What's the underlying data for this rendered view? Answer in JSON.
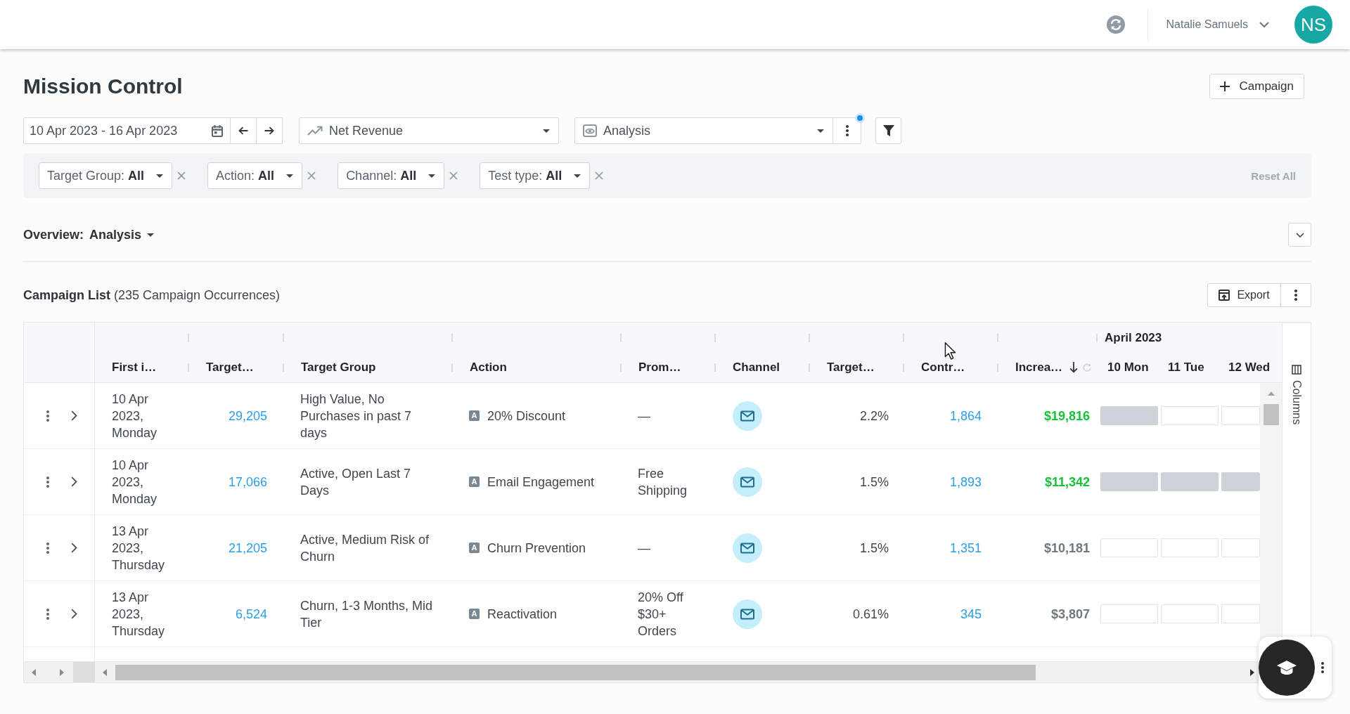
{
  "top_bar": {
    "user_name": "Natalie Samuels",
    "avatar_initials": "NS"
  },
  "header": {
    "title": "Mission Control",
    "new_button": "Campaign"
  },
  "toolbar": {
    "date_range": "10 Apr 2023 - 16 Apr 2023",
    "metric": "Net Revenue",
    "view": "Analysis",
    "view_menu_badge": true
  },
  "filters": {
    "items": [
      {
        "label": "Target Group:",
        "value": "All"
      },
      {
        "label": "Action:",
        "value": "All"
      },
      {
        "label": "Channel:",
        "value": "All"
      },
      {
        "label": "Test type:",
        "value": "All"
      }
    ],
    "reset": {
      "label": "Reset All",
      "disabled": true
    }
  },
  "overview": {
    "label": "Overview:",
    "value": "Analysis"
  },
  "campaign_list": {
    "title": "Campaign List",
    "count": "(235 Campaign Occurrences)",
    "export": "Export"
  },
  "table": {
    "columns": [
      {
        "label": "First i…",
        "kind": "text",
        "sorted": false
      },
      {
        "label": "Target…",
        "kind": "link",
        "sorted": false
      },
      {
        "label": "Target Group",
        "kind": "text",
        "sorted": false
      },
      {
        "label": "Action",
        "kind": "tagged",
        "sorted": false
      },
      {
        "label": "Prom…",
        "kind": "text",
        "sorted": false
      },
      {
        "label": "Channel",
        "kind": "icon",
        "sorted": false
      },
      {
        "label": "Target…",
        "kind": "number",
        "sorted": false
      },
      {
        "label": "Contr…",
        "kind": "link",
        "sorted": false
      },
      {
        "label": "Increa…",
        "kind": "money",
        "sorted": true
      }
    ],
    "group_header": "April 2023",
    "day_columns": [
      "10 Mon",
      "11 Tue",
      "12 Wed"
    ],
    "rows": [
      {
        "significant": true,
        "badge": "A",
        "cells": [
          "10 Apr 2023, Monday",
          "29,205",
          "High Value, No Purchases in past 7 days",
          "20% Discount",
          "—",
          "2.2%",
          "1,864",
          "$19,816"
        ],
        "days": [
          {
            "active": true
          },
          {
            "active": false
          },
          {
            "active": false
          }
        ]
      },
      {
        "significant": true,
        "badge": "A",
        "cells": [
          "10 Apr 2023, Monday",
          "17,066",
          "Active, Open Last 7 Days",
          "Email Engagement",
          "Free Shipping",
          "1.5%",
          "1,893",
          "$11,342"
        ],
        "days": [
          {
            "active": true
          },
          {
            "active": true
          },
          {
            "active": true
          }
        ]
      },
      {
        "significant": false,
        "badge": "A",
        "cells": [
          "13 Apr 2023, Thursday",
          "21,205",
          "Active, Medium Risk of Churn",
          "Churn Prevention",
          "—",
          "1.5%",
          "1,351",
          "$10,181"
        ],
        "days": [
          {
            "active": false
          },
          {
            "active": false
          },
          {
            "active": false
          }
        ]
      },
      {
        "significant": false,
        "badge": "A",
        "cells": [
          "13 Apr 2023, Thursday",
          "6,524",
          "Churn, 1-3 Months, Mid Tier",
          "Reactivation",
          "20% Off $30+ Orders",
          "0.61%",
          "345",
          "$3,807"
        ],
        "days": [
          {
            "active": false
          },
          {
            "active": false
          },
          {
            "active": false
          }
        ]
      }
    ],
    "side_panel_label": "Columns"
  }
}
